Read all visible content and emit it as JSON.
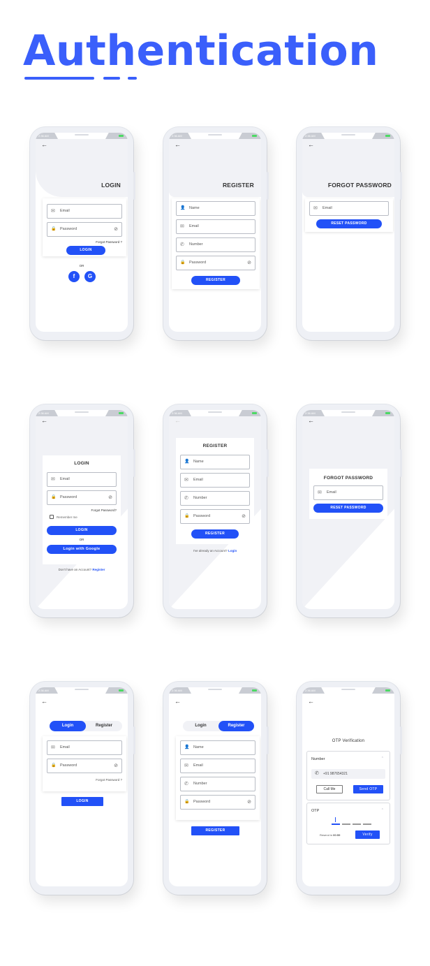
{
  "page_title": "Authentication",
  "accent_color": "#2251f7",
  "status_time": "2:36 AM",
  "icons": {
    "back": "←",
    "email": "✉",
    "lock": "🔒",
    "eye_off": "⊘",
    "user": "👤",
    "phone": "✆",
    "facebook": "f",
    "google": "G",
    "chevron_up": "⌃"
  },
  "screens": {
    "login1": {
      "title": "LOGIN",
      "email_placeholder": "Email",
      "password_placeholder": "Password",
      "forgot": "Forgot Password ?",
      "login_btn": "LOGIN",
      "or": "OR"
    },
    "register1": {
      "title": "REGISTER",
      "name_placeholder": "Name",
      "email_placeholder": "Email",
      "number_placeholder": "Number",
      "password_placeholder": "Password",
      "register_btn": "REGISTER"
    },
    "forgot1": {
      "title": "FORGOT PASSWORD",
      "email_placeholder": "Email",
      "reset_btn": "RESET PASSWORD"
    },
    "login2": {
      "title": "LOGIN",
      "email_placeholder": "Email",
      "password_placeholder": "Password",
      "forgot": "Forgot Password?",
      "remember": "Remember me",
      "login_btn": "LOGIN",
      "or": "OR",
      "google_btn": "Login with Google",
      "no_account": "Don't have an Account?",
      "register_link": "Register"
    },
    "register2": {
      "title": "REGISTER",
      "name_placeholder": "Name",
      "email_placeholder": "Email",
      "number_placeholder": "Number",
      "password_placeholder": "Password",
      "register_btn": "REGISTER",
      "have_account": "I've already an Account?",
      "login_link": "Login"
    },
    "forgot2": {
      "title": "FORGOT PASSWORD",
      "email_placeholder": "Email",
      "reset_btn": "RESET PASSWORD"
    },
    "login3": {
      "tab_login": "Login",
      "tab_register": "Register",
      "email_placeholder": "Email",
      "password_placeholder": "Password",
      "forgot": "Forgot Password ?",
      "login_btn": "LOGIN"
    },
    "register3": {
      "tab_login": "Login",
      "tab_register": "Register",
      "name_placeholder": "Name",
      "email_placeholder": "Email",
      "number_placeholder": "Number",
      "password_placeholder": "Password",
      "register_btn": "REGISTER"
    },
    "otp": {
      "title": "OTP Verification",
      "number_section": "Number",
      "phone_value": "+91 987654321",
      "call_me": "Call Me",
      "send_otp": "Send OTP",
      "otp_section": "OTP",
      "resend_label": "Resend in",
      "resend_timer": "00:59",
      "verify": "Verify"
    }
  }
}
